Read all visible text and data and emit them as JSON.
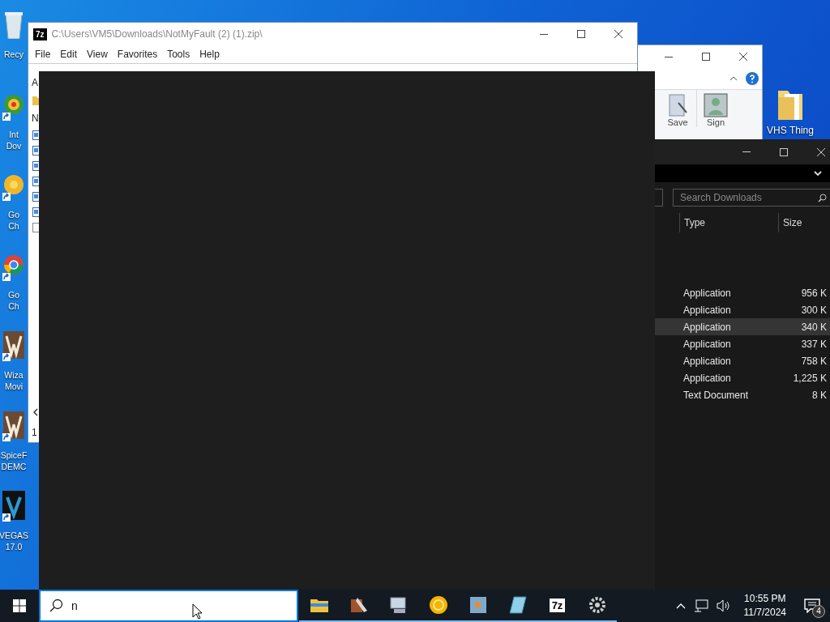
{
  "desktop_icons": [
    {
      "kind": "recycle",
      "lines": [
        "Recy"
      ],
      "shortcut": false
    },
    {
      "kind": "download",
      "lines": [
        "Int",
        "Dov"
      ],
      "shortcut": true
    },
    {
      "kind": "yellow-browser",
      "lines": [
        "Go",
        "Ch"
      ],
      "shortcut": true
    },
    {
      "kind": "browser",
      "lines": [
        "Go",
        "Ch"
      ],
      "shortcut": true
    },
    {
      "kind": "movie",
      "lines": [
        "Wiza",
        "Movi"
      ],
      "shortcut": true
    },
    {
      "kind": "movie",
      "lines": [
        "SpiceF",
        "DEMC"
      ],
      "shortcut": true
    },
    {
      "kind": "vegas",
      "lines": [
        "VEGAS",
        "17.0"
      ],
      "shortcut": true
    }
  ],
  "zip_window": {
    "logo": "7z",
    "title": "C:\\Users\\VM5\\Downloads\\NotMyFault (2) (1).zip\\",
    "menu": [
      "File",
      "Edit",
      "View",
      "Favorites",
      "Tools",
      "Help"
    ],
    "address_fragment": "A",
    "column_fragment": "N",
    "status_fragment": "1"
  },
  "explorer_window": {
    "ribbon_buttons": [
      {
        "kind": "save",
        "label": "Save"
      },
      {
        "kind": "sign",
        "label": "Sign"
      }
    ]
  },
  "desktop_folder": {
    "label": "VHS Thing"
  },
  "downloads_window": {
    "search": {
      "placeholder": "Search Downloads"
    },
    "columns": [
      "Type",
      "Size"
    ],
    "rows": [
      {
        "type": "Application",
        "size": "956 K",
        "selected": false
      },
      {
        "type": "Application",
        "size": "300 K",
        "selected": false
      },
      {
        "type": "Application",
        "size": "340 K",
        "selected": true
      },
      {
        "type": "Application",
        "size": "337 K",
        "selected": false
      },
      {
        "type": "Application",
        "size": "758 K",
        "selected": false
      },
      {
        "type": "Application",
        "size": "1,225 K",
        "selected": false
      },
      {
        "type": "Text Document",
        "size": "8 K",
        "selected": false
      }
    ]
  },
  "taskbar": {
    "search": {
      "value": "n"
    },
    "apps": [
      {
        "kind": "explorer"
      },
      {
        "kind": "paint"
      },
      {
        "kind": "computer"
      },
      {
        "kind": "circle"
      },
      {
        "kind": "media"
      },
      {
        "kind": "notepad"
      },
      {
        "kind": "sevenzip",
        "label": "7z"
      },
      {
        "kind": "gear"
      }
    ],
    "clock": {
      "time": "10:55 PM",
      "date": "11/7/2024"
    },
    "notifications": {
      "count": "4"
    }
  }
}
